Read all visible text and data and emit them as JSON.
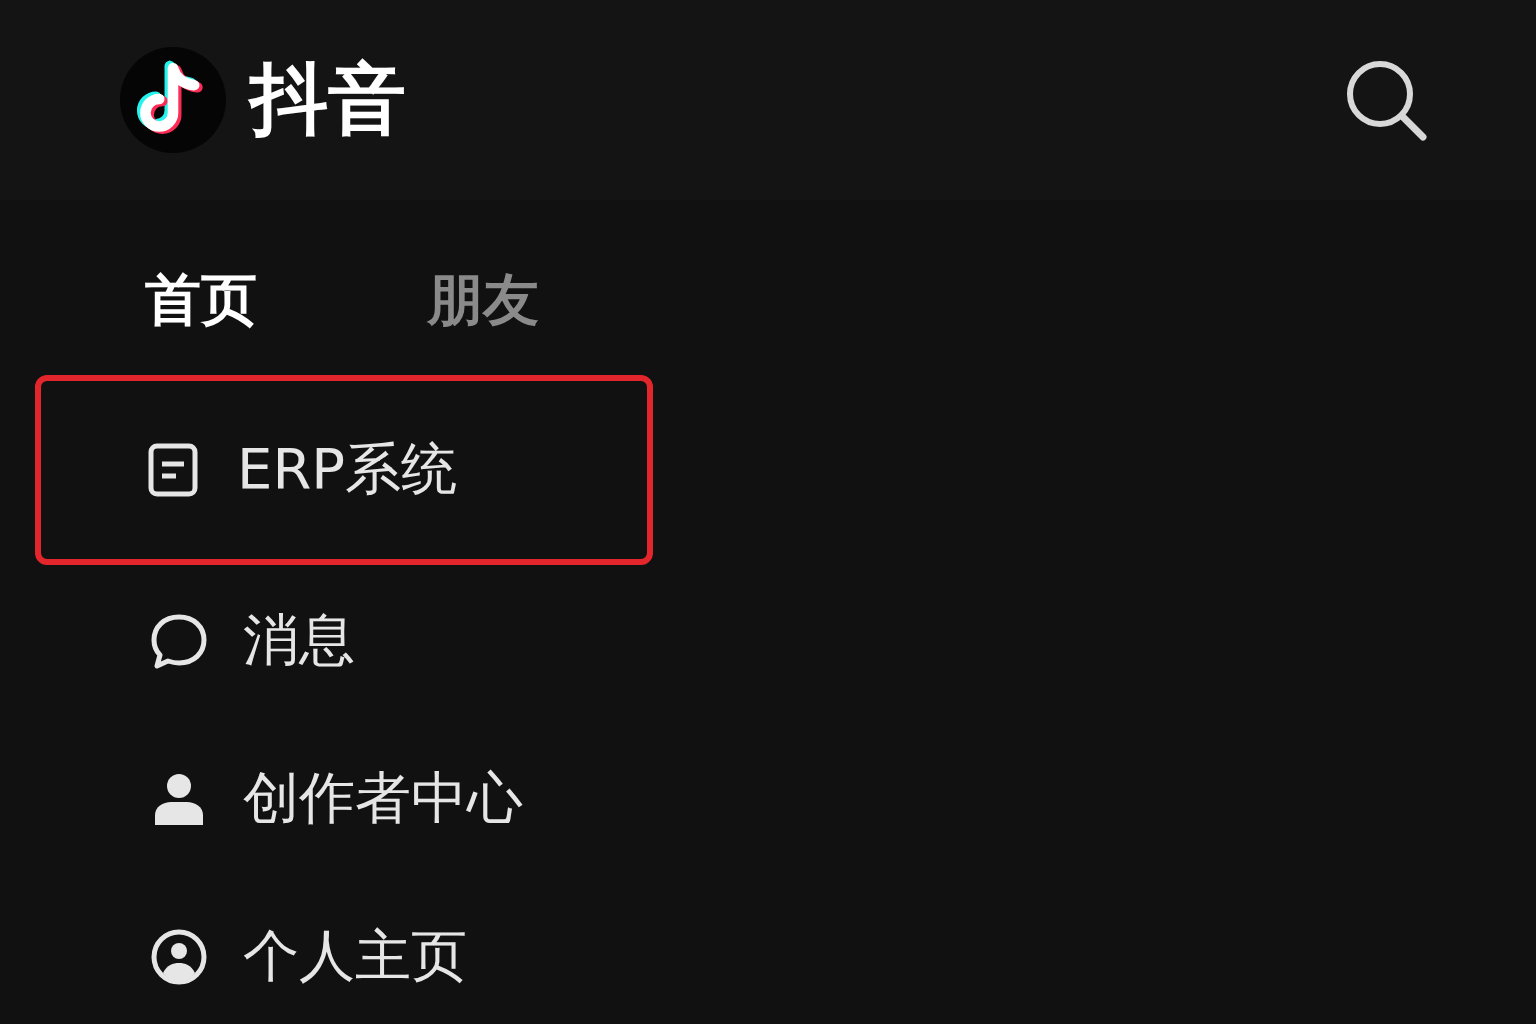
{
  "header": {
    "title": "抖音"
  },
  "tabs": [
    {
      "label": "首页",
      "selected": true
    },
    {
      "label": "朋友",
      "selected": false
    }
  ],
  "menu": [
    {
      "kind": "document",
      "label": "ERP系统",
      "highlighted": true
    },
    {
      "kind": "chat",
      "label": "消息",
      "highlighted": false
    },
    {
      "kind": "person",
      "label": "创作者中心",
      "highlighted": false
    },
    {
      "kind": "profile",
      "label": "个人主页",
      "highlighted": false
    }
  ]
}
